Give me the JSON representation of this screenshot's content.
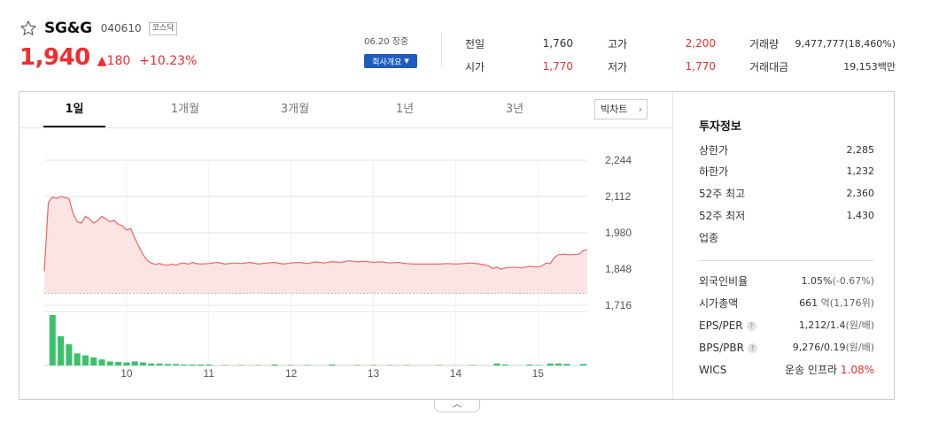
{
  "stock": {
    "name": "SG&G",
    "code": "040610",
    "market": "코스닥",
    "price": "1,940",
    "change": "180",
    "change_pct": "+10.23%",
    "date_status": "06.20 장중",
    "corp_btn": "회사개요"
  },
  "quote": {
    "prev_label": "전일",
    "prev": "1,760",
    "open_label": "시가",
    "open": "1,770",
    "high_label": "고가",
    "high": "2,200",
    "low_label": "저가",
    "low": "1,770",
    "volume_label": "거래량",
    "volume": "9,477,777(18,460%)",
    "amount_label": "거래대금",
    "amount": "19,153백만"
  },
  "tabs": [
    {
      "label": "1일",
      "active": true
    },
    {
      "label": "1개월"
    },
    {
      "label": "3개월"
    },
    {
      "label": "1년"
    },
    {
      "label": "3년"
    }
  ],
  "big_chart_label": "빅차트",
  "info": {
    "title": "투자정보",
    "upper_label": "상한가",
    "upper": "2,285",
    "lower_label": "하한가",
    "lower": "1,232",
    "high52_label": "52주 최고",
    "high52": "2,360",
    "low52_label": "52주 최저",
    "low52": "1,430",
    "sector_label": "업종",
    "foreign_label": "외국인비율",
    "foreign": "1.05%",
    "foreign_chg": "(-0.67%)",
    "mcap_label": "시가총액",
    "mcap": "661",
    "mcap_unit": "억",
    "mcap_rank": "(1,176위)",
    "eps_label": "EPS/PER",
    "eps": "1,212/1.4",
    "eps_unit": "(원/배)",
    "bps_label": "BPS/PBR",
    "bps": "9,276/0.19",
    "bps_unit": "(원/배)",
    "wics_label": "WICS",
    "wics": "운송 인프라",
    "wics_pct": "1.08%"
  },
  "colors": {
    "up": "#f02d2d",
    "down": "#1e5bbf",
    "line": "#f06565",
    "area": "#fde4e4",
    "volume": "#3bc16a"
  },
  "chart_data": {
    "type": "line",
    "ylim": [
      1716,
      2244
    ],
    "yticks": [
      "2,244",
      "2,112",
      "1,980",
      "1,848",
      "1,716"
    ],
    "ytick_values": [
      2244,
      2112,
      1980,
      1848,
      1716
    ],
    "xticks": [
      "10",
      "11",
      "12",
      "13",
      "14",
      "15"
    ],
    "xtick_values": [
      10,
      11,
      12,
      13,
      14,
      15
    ],
    "xlim": [
      9.0,
      15.6
    ],
    "baseline": 1760,
    "price_series": [
      [
        9.0,
        1840
      ],
      [
        9.05,
        2090
      ],
      [
        9.1,
        2110
      ],
      [
        9.15,
        2105
      ],
      [
        9.2,
        2112
      ],
      [
        9.25,
        2108
      ],
      [
        9.3,
        2105
      ],
      [
        9.35,
        2050
      ],
      [
        9.4,
        2020
      ],
      [
        9.45,
        2015
      ],
      [
        9.5,
        2040
      ],
      [
        9.55,
        2030
      ],
      [
        9.6,
        2015
      ],
      [
        9.65,
        2025
      ],
      [
        9.7,
        2040
      ],
      [
        9.75,
        2030
      ],
      [
        9.8,
        2020
      ],
      [
        9.85,
        2025
      ],
      [
        9.9,
        2010
      ],
      [
        9.95,
        2005
      ],
      [
        10.0,
        1990
      ],
      [
        10.05,
        1995
      ],
      [
        10.1,
        1960
      ],
      [
        10.15,
        1930
      ],
      [
        10.2,
        1900
      ],
      [
        10.25,
        1880
      ],
      [
        10.3,
        1870
      ],
      [
        10.35,
        1865
      ],
      [
        10.4,
        1868
      ],
      [
        10.45,
        1863
      ],
      [
        10.5,
        1862
      ],
      [
        10.55,
        1866
      ],
      [
        10.6,
        1862
      ],
      [
        10.65,
        1868
      ],
      [
        10.7,
        1870
      ],
      [
        10.75,
        1866
      ],
      [
        10.8,
        1872
      ],
      [
        10.85,
        1868
      ],
      [
        10.9,
        1866
      ],
      [
        11.0,
        1868
      ],
      [
        11.1,
        1872
      ],
      [
        11.2,
        1866
      ],
      [
        11.3,
        1870
      ],
      [
        11.4,
        1868
      ],
      [
        11.5,
        1872
      ],
      [
        11.6,
        1866
      ],
      [
        11.7,
        1870
      ],
      [
        11.8,
        1872
      ],
      [
        11.9,
        1866
      ],
      [
        12.0,
        1870
      ],
      [
        12.1,
        1872
      ],
      [
        12.2,
        1868
      ],
      [
        12.3,
        1874
      ],
      [
        12.4,
        1870
      ],
      [
        12.5,
        1875
      ],
      [
        12.6,
        1872
      ],
      [
        12.7,
        1878
      ],
      [
        12.8,
        1874
      ],
      [
        12.9,
        1876
      ],
      [
        13.0,
        1872
      ],
      [
        13.1,
        1874
      ],
      [
        13.2,
        1870
      ],
      [
        13.3,
        1872
      ],
      [
        13.4,
        1868
      ],
      [
        13.5,
        1866
      ],
      [
        13.6,
        1866
      ],
      [
        13.7,
        1866
      ],
      [
        13.8,
        1866
      ],
      [
        13.9,
        1868
      ],
      [
        14.0,
        1866
      ],
      [
        14.1,
        1868
      ],
      [
        14.2,
        1870
      ],
      [
        14.3,
        1866
      ],
      [
        14.4,
        1860
      ],
      [
        14.45,
        1850
      ],
      [
        14.5,
        1855
      ],
      [
        14.55,
        1848
      ],
      [
        14.6,
        1852
      ],
      [
        14.7,
        1855
      ],
      [
        14.8,
        1852
      ],
      [
        14.9,
        1858
      ],
      [
        15.0,
        1855
      ],
      [
        15.05,
        1860
      ],
      [
        15.1,
        1870
      ],
      [
        15.15,
        1868
      ],
      [
        15.2,
        1890
      ],
      [
        15.25,
        1900
      ],
      [
        15.3,
        1902
      ],
      [
        15.4,
        1900
      ],
      [
        15.5,
        1902
      ],
      [
        15.55,
        1915
      ],
      [
        15.6,
        1918
      ]
    ],
    "volume_series": [
      [
        9.1,
        100
      ],
      [
        9.2,
        58
      ],
      [
        9.3,
        42
      ],
      [
        9.4,
        24
      ],
      [
        9.5,
        20
      ],
      [
        9.6,
        16
      ],
      [
        9.7,
        12
      ],
      [
        9.8,
        8
      ],
      [
        9.9,
        7
      ],
      [
        10.0,
        6
      ],
      [
        10.1,
        8
      ],
      [
        10.2,
        6
      ],
      [
        10.3,
        4
      ],
      [
        10.4,
        4
      ],
      [
        10.5,
        3
      ],
      [
        10.6,
        3
      ],
      [
        10.7,
        2
      ],
      [
        10.8,
        2
      ],
      [
        10.9,
        2
      ],
      [
        11.0,
        2
      ],
      [
        11.2,
        1
      ],
      [
        11.4,
        1
      ],
      [
        11.6,
        1
      ],
      [
        11.8,
        2
      ],
      [
        12.0,
        1
      ],
      [
        12.2,
        1
      ],
      [
        12.5,
        2
      ],
      [
        12.8,
        1
      ],
      [
        13.0,
        1
      ],
      [
        13.2,
        1
      ],
      [
        13.4,
        1
      ],
      [
        13.8,
        1
      ],
      [
        14.2,
        1
      ],
      [
        14.5,
        4
      ],
      [
        14.6,
        2
      ],
      [
        14.9,
        2
      ],
      [
        15.0,
        1
      ],
      [
        15.15,
        4
      ],
      [
        15.25,
        4
      ],
      [
        15.35,
        3
      ],
      [
        15.55,
        3
      ]
    ]
  }
}
